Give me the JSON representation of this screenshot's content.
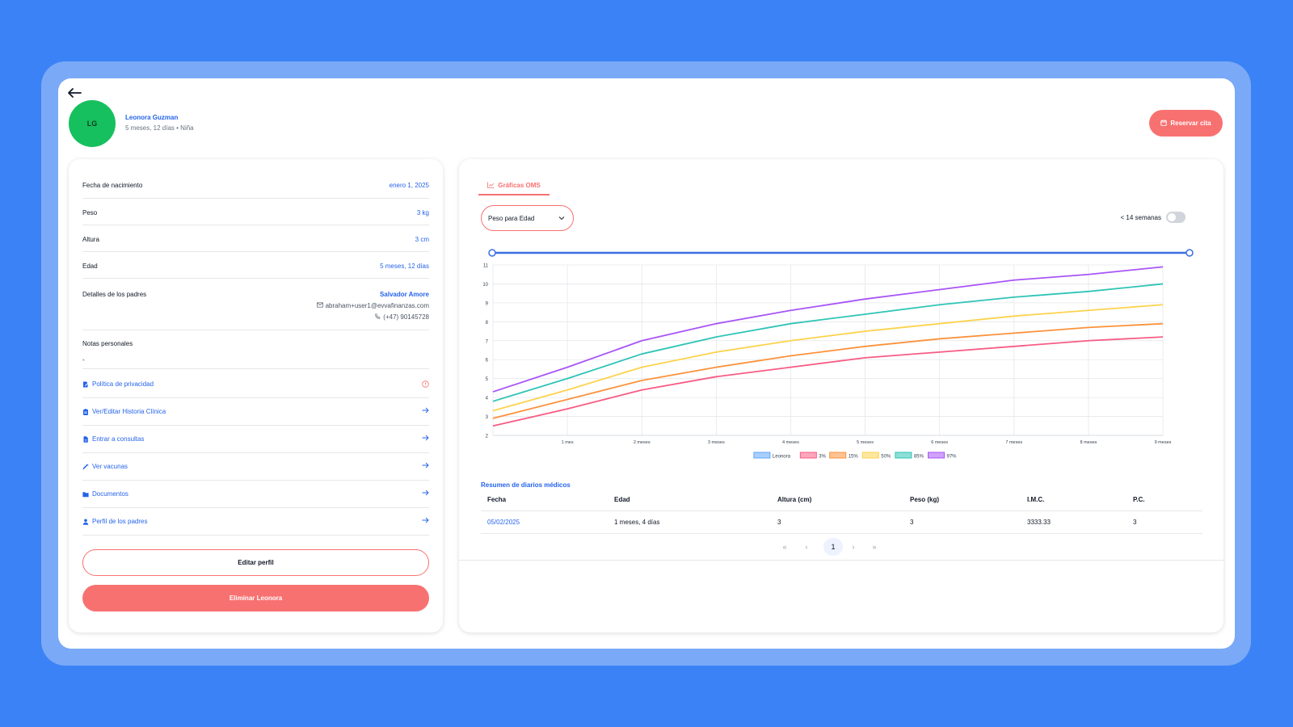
{
  "patient": {
    "initials": "LG",
    "name": "Leonora Guzman",
    "info": "5 meses, 12 días • Niña"
  },
  "header": {
    "reserve_label": "Reservar cita",
    "back_icon": "arrow-left-icon"
  },
  "details": [
    {
      "label": "Fecha de nacimiento",
      "value": "enero 1, 2025"
    },
    {
      "label": "Peso",
      "value": "3 kg"
    },
    {
      "label": "Altura",
      "value": "3 cm"
    },
    {
      "label": "Edad",
      "value": "5 meses, 12 días"
    }
  ],
  "parents": {
    "label": "Detalles de los padres",
    "name": "Salvador Amore",
    "email": "abraham+user1@evvafinanzas.com",
    "phone": "(+47) 90145728"
  },
  "notes": {
    "label": "Notas personales",
    "value": "-"
  },
  "nav": [
    {
      "label": "Política de privacidad",
      "icon": "document-edit-icon",
      "trail": "alert-circle-icon"
    },
    {
      "label": "Ver/Editar Historia Clínica",
      "icon": "clipboard-icon",
      "trail": "arrow-right-icon"
    },
    {
      "label": "Entrar a consultas",
      "icon": "file-icon",
      "trail": "arrow-right-icon"
    },
    {
      "label": "Ver vacunas",
      "icon": "syringe-icon",
      "trail": "arrow-right-icon"
    },
    {
      "label": "Documentos",
      "icon": "folder-icon",
      "trail": "arrow-right-icon"
    },
    {
      "label": "Perfil de los padres",
      "icon": "user-icon",
      "trail": "arrow-right-icon"
    }
  ],
  "actions": {
    "edit_label": "Editar perfil",
    "delete_label": "Eliminar Leonora"
  },
  "chart_panel": {
    "tab_label": "Gráficas OMS",
    "select_value": "Peso para Edad",
    "toggle_label": "< 14 semanas",
    "toggle_on": false
  },
  "colors": {
    "accent": "#f87171",
    "link": "#2563eb",
    "avatar": "#16c05e",
    "background": "#3b82f6"
  },
  "chart_data": {
    "type": "line",
    "x": [
      0,
      1,
      2,
      3,
      4,
      5,
      6,
      7,
      8,
      9
    ],
    "xticks": [
      "1 mes",
      "2 meses",
      "3 meses",
      "4 meses",
      "5 meses",
      "6 meses",
      "7 meses",
      "8 meses",
      "9 meses"
    ],
    "ylim": [
      2,
      11
    ],
    "yticks": [
      2,
      3,
      4,
      5,
      6,
      7,
      8,
      9,
      10,
      11
    ],
    "grid": true,
    "legend": "bottom",
    "series": [
      {
        "name": "Leonora",
        "color": "#60a5fa",
        "values": []
      },
      {
        "name": "3%",
        "color": "#f75c84",
        "values": [
          2.5,
          3.4,
          4.4,
          5.1,
          5.6,
          6.1,
          6.4,
          6.7,
          7.0,
          7.2
        ]
      },
      {
        "name": "15%",
        "color": "#fb923c",
        "values": [
          2.9,
          3.9,
          4.9,
          5.6,
          6.2,
          6.7,
          7.1,
          7.4,
          7.7,
          7.9
        ]
      },
      {
        "name": "50%",
        "color": "#fcd34d",
        "values": [
          3.3,
          4.4,
          5.6,
          6.4,
          7.0,
          7.5,
          7.9,
          8.3,
          8.6,
          8.9
        ]
      },
      {
        "name": "85%",
        "color": "#2ec4b6",
        "values": [
          3.8,
          5.0,
          6.3,
          7.2,
          7.9,
          8.4,
          8.9,
          9.3,
          9.6,
          10.0
        ]
      },
      {
        "name": "97%",
        "color": "#a855f7",
        "values": [
          4.3,
          5.6,
          7.0,
          7.9,
          8.6,
          9.2,
          9.7,
          10.2,
          10.5,
          10.9
        ]
      }
    ]
  },
  "records": {
    "title": "Resumen de diarios médicos",
    "columns": [
      "Fecha",
      "Edad",
      "Altura (cm)",
      "Peso (kg)",
      "I.M.C.",
      "P.C."
    ],
    "rows": [
      [
        "05/02/2025",
        "1 meses, 4 días",
        "3",
        "3",
        "3333.33",
        "3"
      ]
    ],
    "pagination": {
      "first": "«",
      "prev": "‹",
      "current": "1",
      "next": "›",
      "last": "»"
    }
  }
}
